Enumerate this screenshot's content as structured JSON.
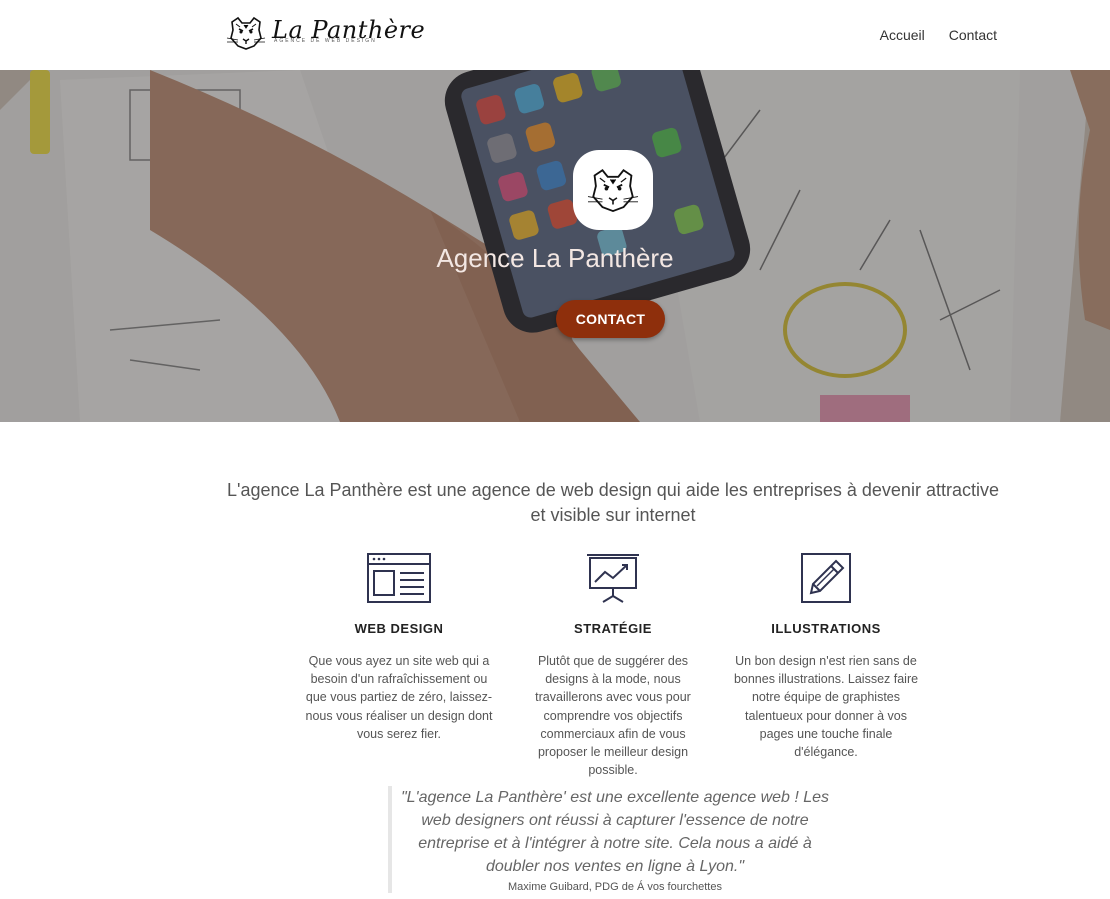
{
  "header": {
    "logo_name": "La Panthère",
    "logo_tagline": "AGENCE DE WEB DESIGN",
    "nav": [
      {
        "label": "Accueil"
      },
      {
        "label": "Contact"
      }
    ]
  },
  "hero": {
    "title": "Agence La Panthère",
    "button_label": "CONTACT"
  },
  "intro": "L'agence La Panthère est une agence de web design qui aide les entreprises à devenir attractive et visible sur internet",
  "features": [
    {
      "icon": "browser-window-icon",
      "title": "WEB DESIGN",
      "text": "Que vous ayez un site web qui a besoin d'un rafraîchissement ou que vous partiez de zéro, laissez-nous vous réaliser un design dont vous serez fier."
    },
    {
      "icon": "presentation-chart-icon",
      "title": "STRATÉGIE",
      "text": "Plutôt que de suggérer des designs à la mode, nous travaillerons avec vous pour comprendre vos objectifs commerciaux afin de vous proposer le meilleur design possible."
    },
    {
      "icon": "pencil-icon",
      "title": "ILLUSTRATIONS",
      "text": "Un bon design n'est rien sans de bonnes illustrations. Laissez faire notre équipe de graphistes talentueux pour donner à vos pages une touche finale d'élégance."
    }
  ],
  "testimonial": {
    "quote": "\"L'agence La Panthère' est une excellente agence web ! Les web designers ont réussi à capturer l'essence de notre entreprise et à l'intégrer à notre site. Cela nous a aidé à doubler nos ventes en ligne à Lyon.\"",
    "author": "Maxime Guibard, PDG de Á vos fourchettes"
  },
  "colors": {
    "button": "#8e2f0c",
    "icon_stroke": "#2f3350",
    "hero_title": "#f3e7e3"
  }
}
